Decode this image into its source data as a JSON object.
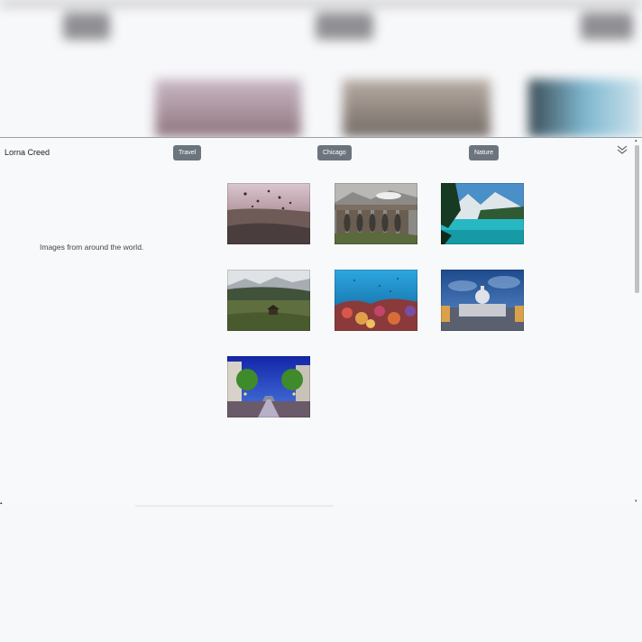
{
  "background_page": {
    "note_icons": [
      "blurred-nav-button",
      "blurred-nav-button",
      "blurred-nav-button"
    ]
  },
  "panel": {
    "title": "Lorna Creed",
    "tags": [
      "Travel",
      "Chicago",
      "Nature"
    ],
    "description": "Images from around the world.",
    "collapse_icon": "double-chevron-down-icon"
  },
  "gallery": {
    "images": [
      {
        "name": "balloons-over-city"
      },
      {
        "name": "stone-viaduct-train"
      },
      {
        "name": "turquoise-mountain-lake"
      },
      {
        "name": "mountain-meadow-cabin"
      },
      {
        "name": "coral-reef"
      },
      {
        "name": "capitol-at-night"
      },
      {
        "name": "city-street-dusk"
      }
    ]
  }
}
